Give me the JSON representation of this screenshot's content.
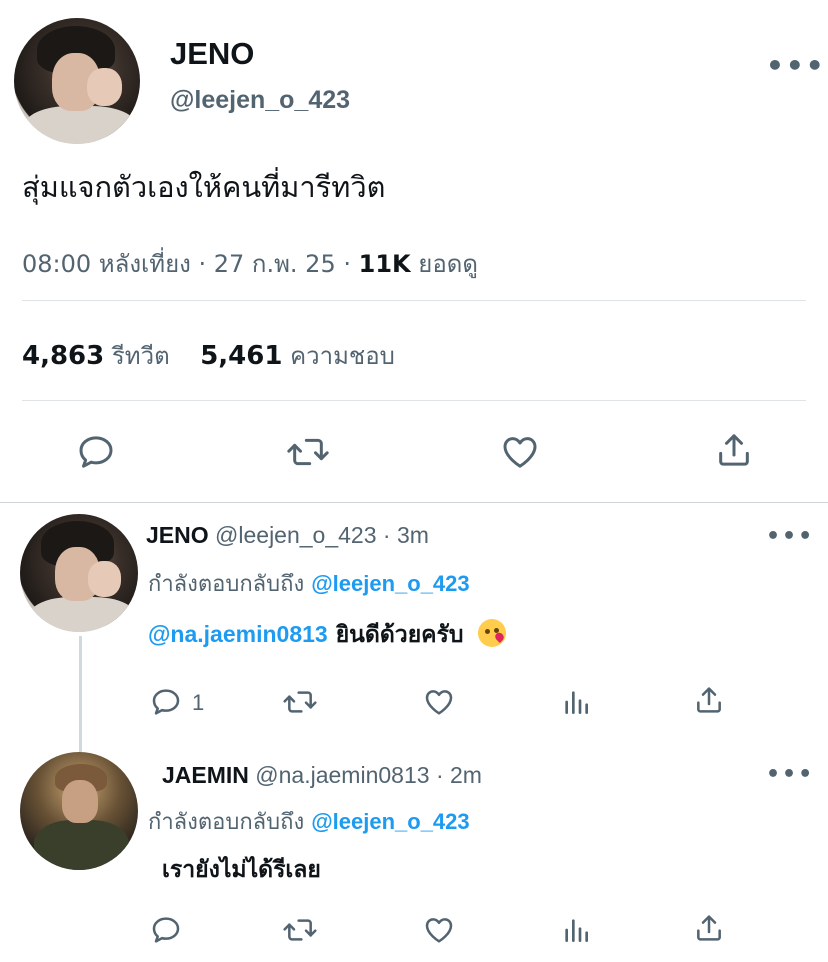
{
  "main_tweet": {
    "display_name": "JENO",
    "handle": "@leejen_o_423",
    "text": "สุ่มแจกตัวเองให้คนที่มารีทวิต",
    "time": "08:00 หลังเที่ยง",
    "date": "27 ก.พ. 25",
    "views_count": "11K",
    "views_label": "ยอดดู",
    "separator": "·",
    "retweets_count": "4,863",
    "retweets_label": "รีทวีต",
    "likes_count": "5,461",
    "likes_label": "ความชอบ",
    "more_label": "•••"
  },
  "replies": [
    {
      "display_name": "JENO",
      "handle": "@leejen_o_423",
      "age": "3m",
      "replying_to_label": "กำลังตอบกลับถึง",
      "replying_to_handle": "@leejen_o_423",
      "mention": "@na.jaemin0813",
      "text": "ยินดีด้วยครับ",
      "reply_count": "1",
      "more_label": "•••"
    },
    {
      "display_name": "JAEMIN",
      "handle": "@na.jaemin0813",
      "age": "2m",
      "replying_to_label": "กำลังตอบกลับถึง",
      "replying_to_handle": "@leejen_o_423",
      "text": "เรายังไม่ได้รีเลย",
      "more_label": "•••"
    }
  ],
  "colors": {
    "link": "#1d9bf0",
    "secondary_text": "#536471",
    "primary_text": "#0f1419",
    "divider": "#dfe3e6"
  },
  "icons": [
    "reply-icon",
    "retweet-icon",
    "like-icon",
    "share-icon",
    "analytics-icon",
    "more-icon",
    "kiss-emoji-icon"
  ]
}
